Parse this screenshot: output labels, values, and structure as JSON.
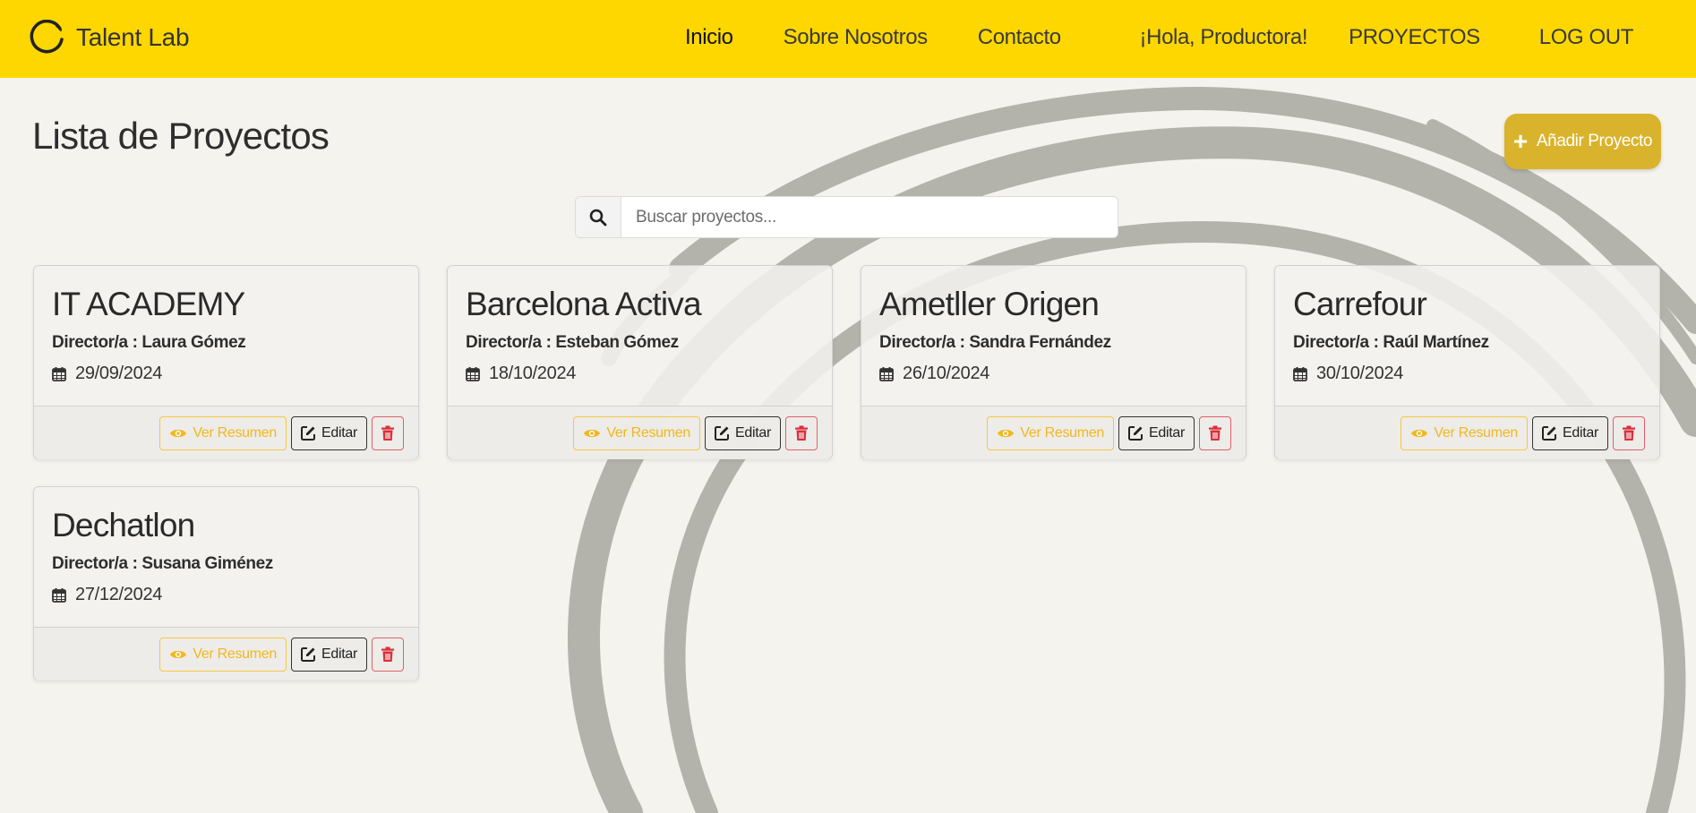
{
  "brand": {
    "name": "Talent Lab"
  },
  "nav": {
    "links": [
      "Inicio",
      "Sobre Nosotros",
      "Contacto"
    ],
    "greeting": "¡Hola, Productora!",
    "projects": "PROYECTOS",
    "logout": "LOG OUT"
  },
  "page": {
    "title": "Lista de Proyectos",
    "add_button": "Añadir Proyecto"
  },
  "search": {
    "placeholder": "Buscar proyectos..."
  },
  "actions": {
    "view": "Ver Resumen",
    "edit": "Editar"
  },
  "projects": [
    {
      "title": "IT ACADEMY",
      "director_label": "Director/a :",
      "director": "Laura Gómez",
      "date": "29/09/2024"
    },
    {
      "title": "Barcelona Activa",
      "director_label": "Director/a :",
      "director": "Esteban Gómez",
      "date": "18/10/2024"
    },
    {
      "title": "Ametller Origen",
      "director_label": "Director/a :",
      "director": "Sandra Fernández",
      "date": "26/10/2024"
    },
    {
      "title": "Carrefour",
      "director_label": "Director/a :",
      "director": "Raúl Martínez",
      "date": "30/10/2024"
    },
    {
      "title": "Dechatlon",
      "director_label": "Director/a :",
      "director": "Susana Giménez",
      "date": "27/12/2024"
    }
  ],
  "colors": {
    "navbar": "#ffd700",
    "background": "#f5f3ee",
    "accent_button": "#d9b32b",
    "view": "#f0b81c",
    "delete": "#d9303d"
  }
}
